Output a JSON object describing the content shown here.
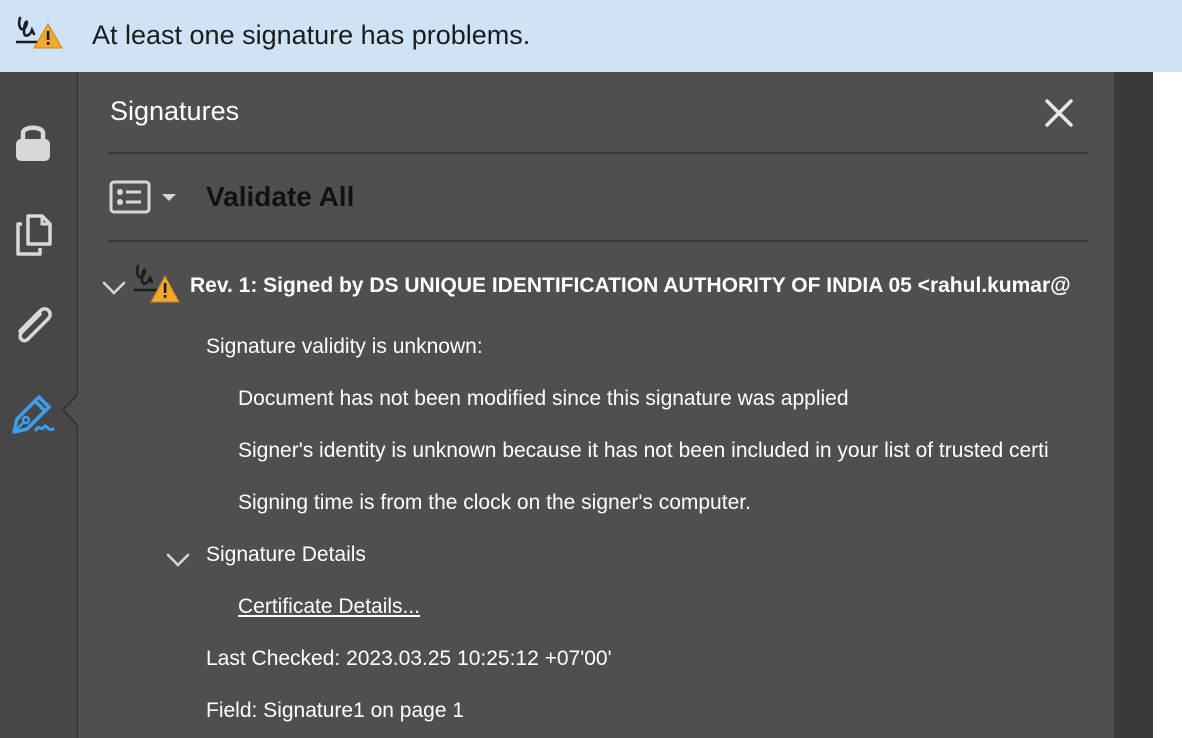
{
  "banner": {
    "icon": "signature-warning-icon",
    "message": "At least one signature has problems."
  },
  "rail": {
    "items": [
      {
        "icon": "lock-icon",
        "active": false
      },
      {
        "icon": "pages-icon",
        "active": false
      },
      {
        "icon": "paperclip-icon",
        "active": false
      },
      {
        "icon": "signature-pen-icon",
        "active": true
      }
    ],
    "active_color": "#3b9ff0"
  },
  "panel": {
    "title": "Signatures",
    "close_icon": "close-icon",
    "validate_all_label": "Validate All",
    "options_icon": "signature-list-options-icon",
    "revision": {
      "title": "Rev. 1: Signed by DS UNIQUE IDENTIFICATION AUTHORITY OF INDIA 05 <rahul.kumar@",
      "icon": "signature-warning-icon",
      "validity_heading": "Signature validity is unknown:",
      "validity_items": [
        "Document has not been modified since this signature was applied",
        "Signer's identity is unknown because it has not been included in your list of trusted certi",
        "Signing time is from the clock on the signer's computer."
      ],
      "details_label": "Signature Details",
      "certificate_link": "Certificate Details...",
      "last_checked": "Last Checked: 2023.03.25 10:25:12 +07'00'",
      "field": "Field: Signature1 on page 1"
    }
  },
  "colors": {
    "banner_bg": "#cfe2f6",
    "panel_bg": "#4f4f4f",
    "rail_bg": "#474747",
    "warning": "#f0a830"
  }
}
